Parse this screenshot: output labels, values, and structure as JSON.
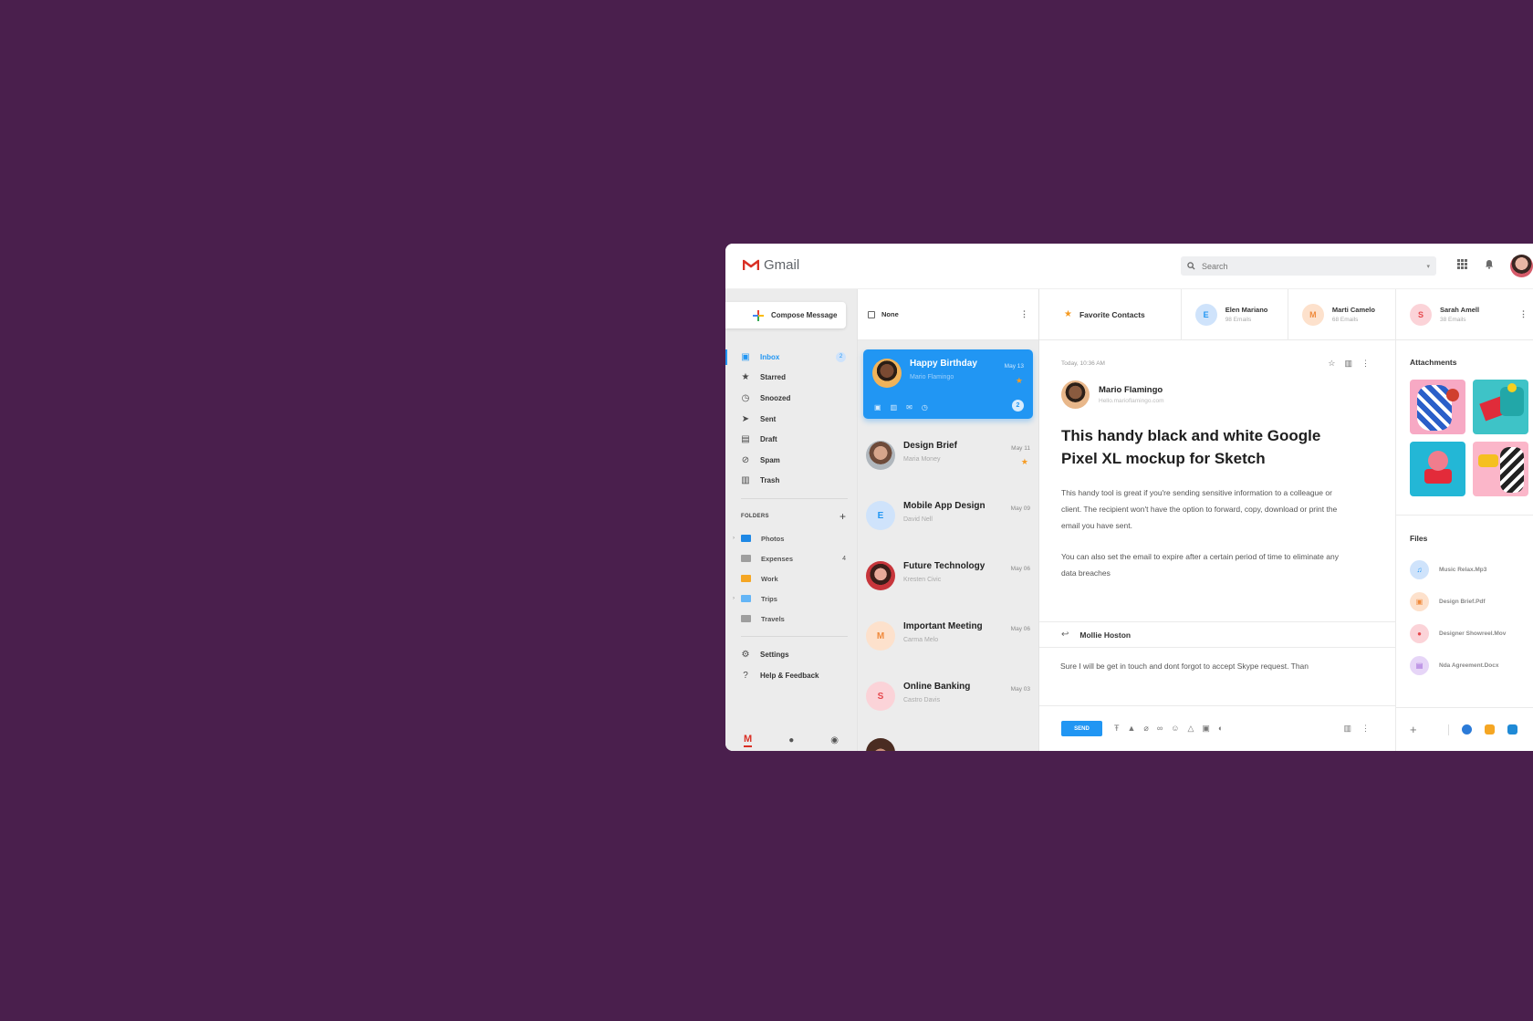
{
  "app": {
    "name": "Gmail"
  },
  "search": {
    "placeholder": "Search"
  },
  "nav": {
    "compose_label": "Compose Message",
    "items": [
      {
        "label": "Inbox",
        "icon": "inbox-icon",
        "badge": "2"
      },
      {
        "label": "Starred",
        "icon": "star-icon"
      },
      {
        "label": "Snoozed",
        "icon": "clock-icon"
      },
      {
        "label": "Sent",
        "icon": "send-icon"
      },
      {
        "label": "Draft",
        "icon": "draft-icon"
      },
      {
        "label": "Spam",
        "icon": "spam-icon"
      },
      {
        "label": "Trash",
        "icon": "trash-icon"
      }
    ],
    "folders_title": "FOLDERS",
    "folders": [
      {
        "label": "Photos",
        "color": "#1e88e5"
      },
      {
        "label": "Expenses",
        "color": "#9e9e9e",
        "count": "4"
      },
      {
        "label": "Work",
        "color": "#f5a623"
      },
      {
        "label": "Trips",
        "color": "#64b5f6"
      },
      {
        "label": "Travels",
        "color": "#9e9e9e"
      }
    ],
    "settings_label": "Settings",
    "help_label": "Help & Feedback"
  },
  "list": {
    "select_label": "None",
    "messages": [
      {
        "subject": "Happy Birthday",
        "from": "Mario Flamingo",
        "date": "May 13",
        "count": "2"
      },
      {
        "subject": "Design Brief",
        "from": "Maria Money",
        "date": "May 11"
      },
      {
        "subject": "Mobile App Design",
        "from": "David Nell",
        "date": "May 09",
        "initial": "E"
      },
      {
        "subject": "Future Technology",
        "from": "Kresten Civic",
        "date": "May 06"
      },
      {
        "subject": "Important Meeting",
        "from": "Carma Melo",
        "date": "May 06",
        "initial": "M"
      },
      {
        "subject": "Online Banking",
        "from": "Castro Davis",
        "date": "May 03",
        "initial": "S"
      }
    ]
  },
  "favorites": {
    "label": "Favorite Contacts",
    "contacts": [
      {
        "initial": "E",
        "name": "Elen Mariano",
        "count": "98 Emails"
      },
      {
        "initial": "M",
        "name": "Marti Camelo",
        "count": "68 Emails"
      },
      {
        "initial": "S",
        "name": "Sarah Amell",
        "count": "38 Emails"
      }
    ]
  },
  "mail": {
    "date": "Today, 10:36 AM",
    "sender_name": "Mario Flamingo",
    "sender_email": "Hello.marioflamingo.com",
    "title": "This handy black and white Google Pixel XL mockup for Sketch",
    "para1": "This handy tool is great if you're sending sensitive information to a colleague or client. The recipient won't have the option to forward, copy, download or print the email you have sent.",
    "para2": "You can also set the email to expire after a certain period of time to eliminate any data breaches",
    "reply_to": "Mollie Hoston",
    "reply_text": "Sure I will be get in touch and dont forgot to accept Skype request. Than",
    "send_label": "SEND"
  },
  "side": {
    "attachments_title": "Attachments",
    "files_title": "Files",
    "files": [
      {
        "name": "Music Relax.Mp3",
        "icon": "music-icon",
        "color": "#cfe3fb",
        "fg": "#2196f3"
      },
      {
        "name": "Design Brief.Pdf",
        "icon": "pdf-icon",
        "color": "#fde1cc",
        "fg": "#f08a3c"
      },
      {
        "name": "Designer Showreel.Mov",
        "icon": "play-icon",
        "color": "#fbd3d8",
        "fg": "#e5484d"
      },
      {
        "name": "Nda Agreement.Docx",
        "icon": "doc-icon",
        "color": "#e6d5f7",
        "fg": "#9c5fd6"
      }
    ]
  }
}
